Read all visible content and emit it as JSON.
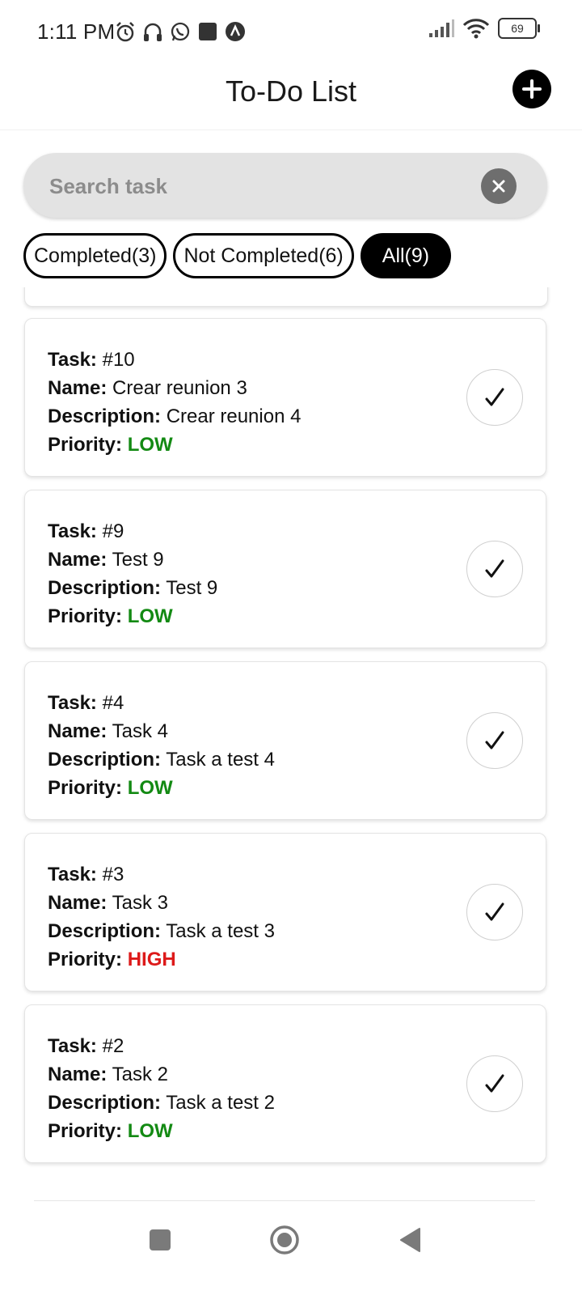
{
  "status_bar": {
    "time": "1:11 PM",
    "battery": "69",
    "left_icons": [
      "alarm-icon",
      "headset-icon",
      "whatsapp-icon",
      "square-app-icon",
      "a-app-icon"
    ],
    "right_icons": [
      "signal-icon",
      "wifi-icon",
      "battery-icon"
    ]
  },
  "header": {
    "title": "To-Do List",
    "add_icon": "plus-icon"
  },
  "search": {
    "placeholder": "Search task",
    "value": "",
    "clear_icon": "close-icon"
  },
  "filters": [
    {
      "label": "Completed(3)",
      "active": false
    },
    {
      "label": "Not Completed(6)",
      "active": false
    },
    {
      "label": "All(9)",
      "active": true
    }
  ],
  "field_labels": {
    "task": "Task:",
    "name": "Name:",
    "description": "Description:",
    "priority": "Priority:"
  },
  "tasks": [
    {
      "id": "#10",
      "name": "Crear reunion 3",
      "description": "Crear reunion 4",
      "priority": "LOW"
    },
    {
      "id": "#9",
      "name": "Test 9",
      "description": "Test 9",
      "priority": "LOW"
    },
    {
      "id": "#4",
      "name": "Task 4",
      "description": "Task a test 4",
      "priority": "LOW"
    },
    {
      "id": "#3",
      "name": "Task 3",
      "description": "Task a test 3",
      "priority": "HIGH"
    },
    {
      "id": "#2",
      "name": "Task 2",
      "description": "Task a test 2",
      "priority": "LOW"
    }
  ],
  "colors": {
    "priority_low": "#138a13",
    "priority_high": "#dd1a1a",
    "accent": "#000000",
    "search_bg": "#e3e3e3"
  },
  "complete_icon": "checkmark-icon",
  "nav_bar": [
    "recents-icon",
    "home-icon",
    "back-icon"
  ]
}
